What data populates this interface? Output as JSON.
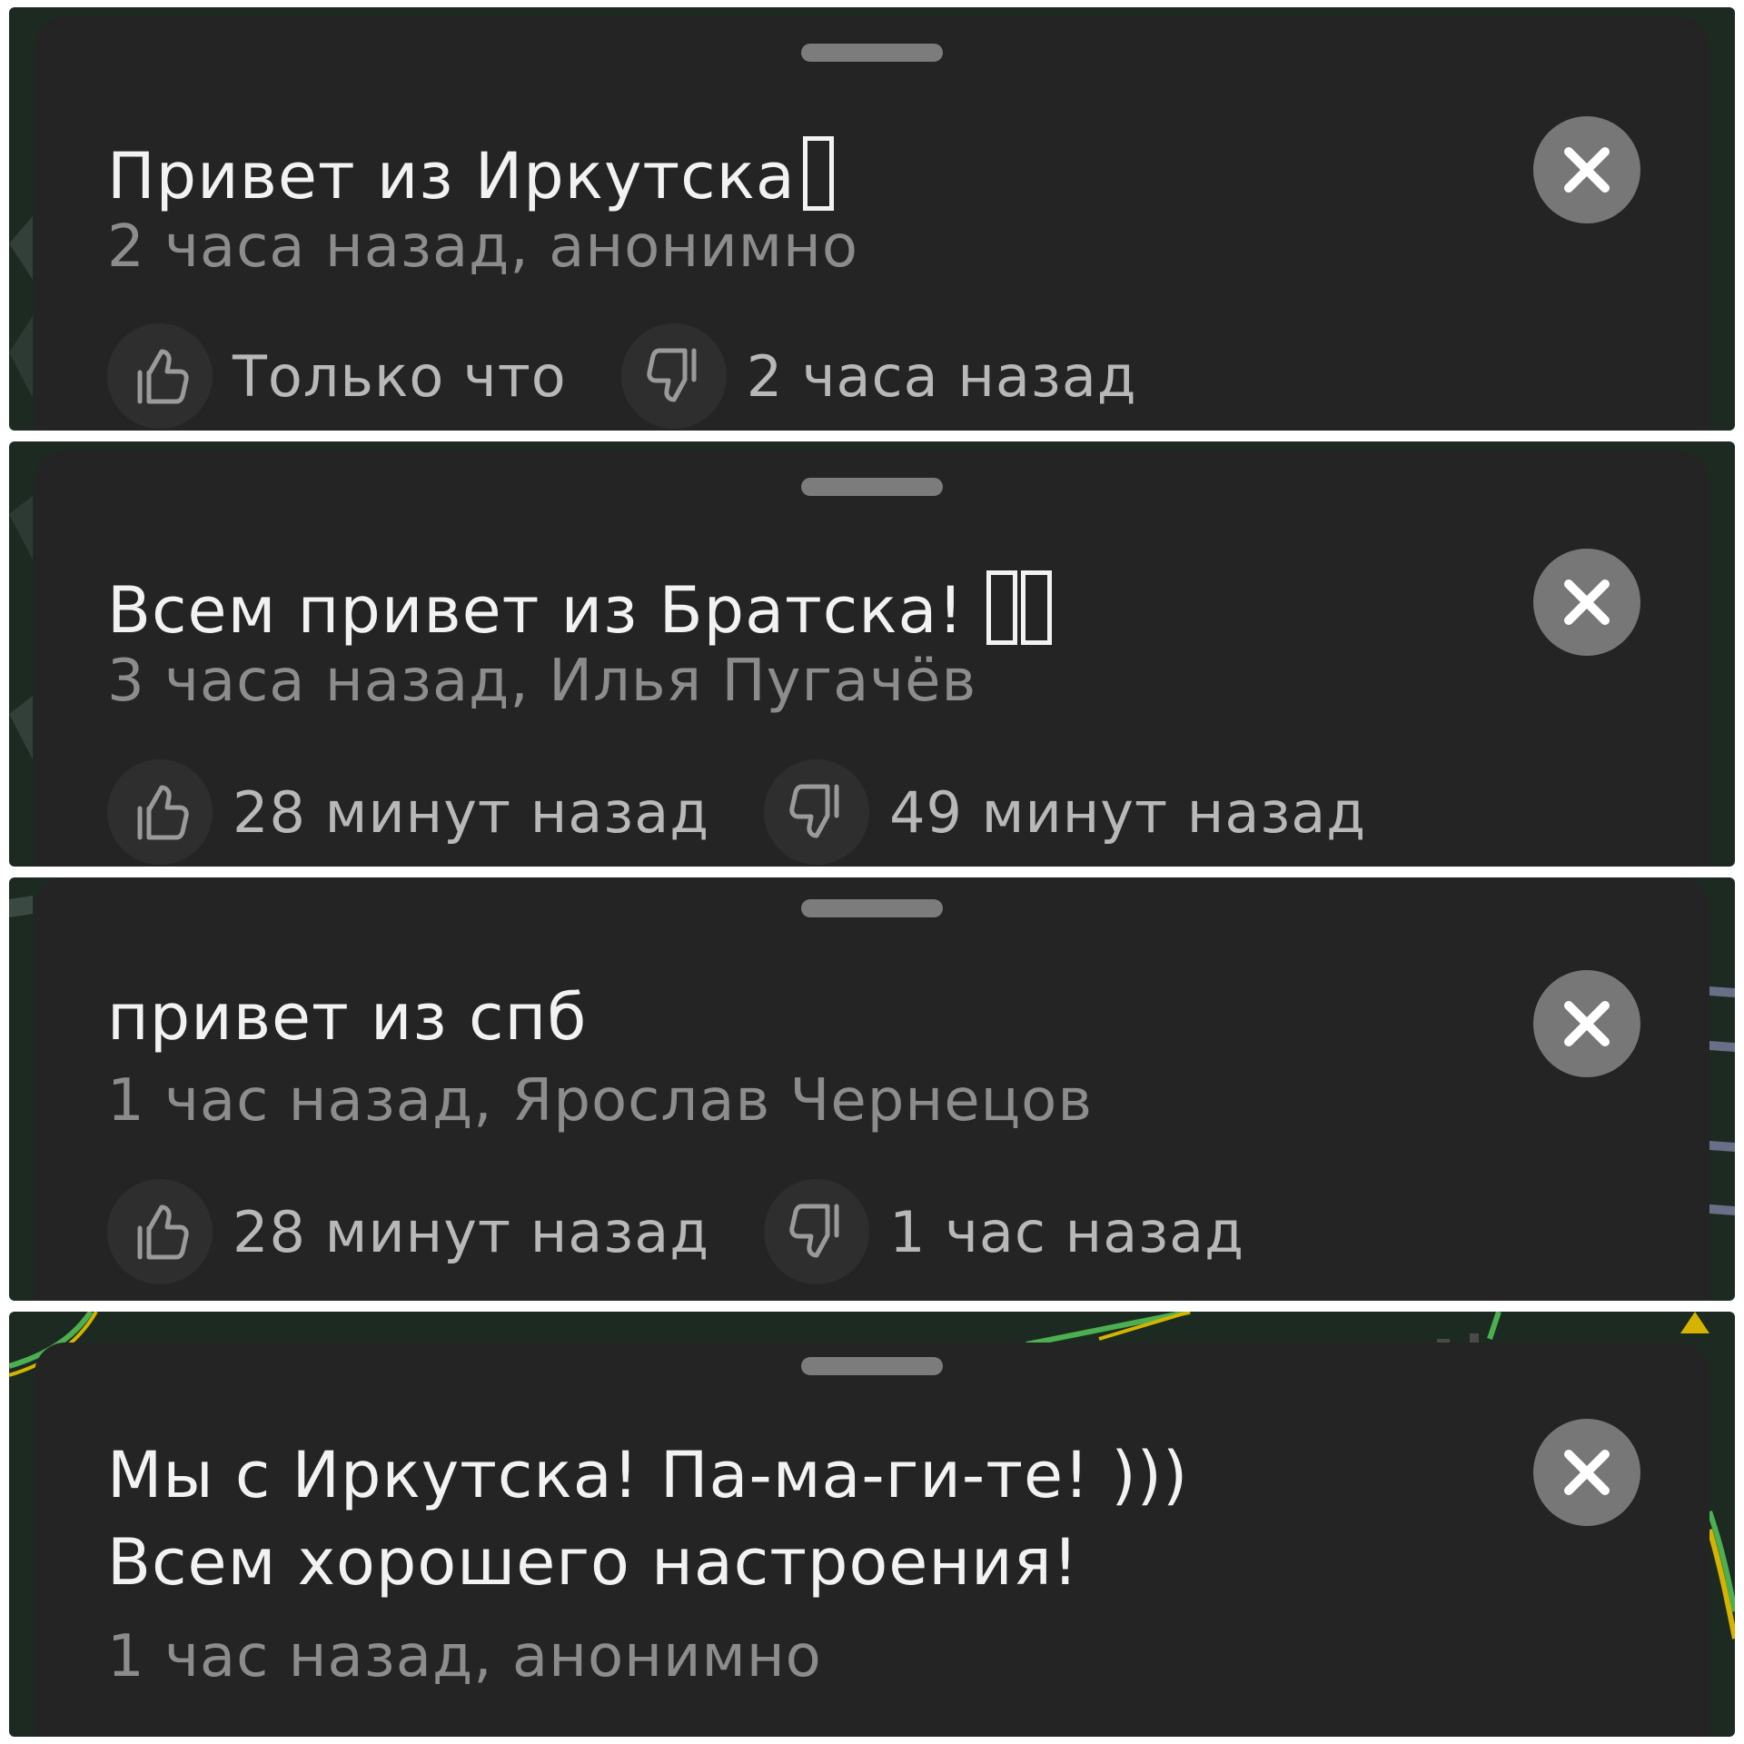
{
  "colors": {
    "sheet_background": "#242424",
    "title_text": "#f2f2f2",
    "subtitle_text": "#8c8c8c",
    "vote_text": "#b8b8b8",
    "close_button": "#777777",
    "map_route_green": "#4caf50",
    "map_route_yellow": "#d4b400"
  },
  "icons": {
    "close": "close-icon",
    "like": "thumbs-up-icon",
    "dislike": "thumbs-down-icon",
    "handle": "drag-handle"
  },
  "comments": [
    {
      "title": "Привет из Иркутска",
      "emoji_boxes": 1,
      "meta": "2 часа назад, анонимно",
      "likes_time": "Только что",
      "dislikes_time": "2 часа назад"
    },
    {
      "title": "Всем привет из Братска!",
      "emoji_boxes": 2,
      "meta": "3 часа назад, Илья Пугачёв",
      "likes_time": "28 минут назад",
      "dislikes_time": "49 минут назад"
    },
    {
      "title": "привет из спб",
      "emoji_boxes": 0,
      "meta": "1 час назад, Ярослав Чернецов",
      "likes_time": "28 минут назад",
      "dislikes_time": "1 час назад"
    },
    {
      "title": "Мы с Иркутска! Па-ма-ги-те! ))) Всем хорошего настроения!",
      "emoji_boxes": 0,
      "meta": "1 час назад, анонимно"
    }
  ]
}
